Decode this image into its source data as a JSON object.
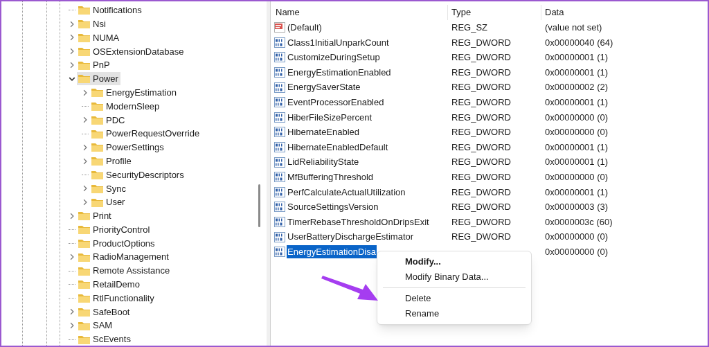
{
  "tree": [
    {
      "label": "Notifications",
      "expandable": false,
      "selected": false
    },
    {
      "label": "Nsi",
      "expandable": true,
      "expanded": false,
      "selected": false
    },
    {
      "label": "NUMA",
      "expandable": true,
      "expanded": false,
      "selected": false
    },
    {
      "label": "OSExtensionDatabase",
      "expandable": true,
      "expanded": false,
      "selected": false
    },
    {
      "label": "PnP",
      "expandable": true,
      "expanded": false,
      "selected": false
    },
    {
      "label": "Power",
      "expandable": true,
      "expanded": true,
      "selected": true,
      "children": [
        {
          "label": "EnergyEstimation",
          "expandable": true,
          "expanded": false,
          "selected": false
        },
        {
          "label": "ModernSleep",
          "expandable": false,
          "selected": false
        },
        {
          "label": "PDC",
          "expandable": true,
          "expanded": false,
          "selected": false
        },
        {
          "label": "PowerRequestOverride",
          "expandable": false,
          "selected": false
        },
        {
          "label": "PowerSettings",
          "expandable": true,
          "expanded": false,
          "selected": false
        },
        {
          "label": "Profile",
          "expandable": true,
          "expanded": false,
          "selected": false
        },
        {
          "label": "SecurityDescriptors",
          "expandable": false,
          "selected": false
        },
        {
          "label": "Sync",
          "expandable": true,
          "expanded": false,
          "selected": false
        },
        {
          "label": "User",
          "expandable": true,
          "expanded": false,
          "selected": false
        }
      ]
    },
    {
      "label": "Print",
      "expandable": true,
      "expanded": false,
      "selected": false
    },
    {
      "label": "PriorityControl",
      "expandable": false,
      "selected": false
    },
    {
      "label": "ProductOptions",
      "expandable": false,
      "selected": false
    },
    {
      "label": "RadioManagement",
      "expandable": true,
      "expanded": false,
      "selected": false
    },
    {
      "label": "Remote Assistance",
      "expandable": false,
      "selected": false
    },
    {
      "label": "RetailDemo",
      "expandable": false,
      "selected": false
    },
    {
      "label": "RtlFunctionality",
      "expandable": false,
      "selected": false
    },
    {
      "label": "SafeBoot",
      "expandable": true,
      "expanded": false,
      "selected": false
    },
    {
      "label": "SAM",
      "expandable": true,
      "expanded": false,
      "selected": false
    },
    {
      "label": "ScEvents",
      "expandable": false,
      "selected": false
    }
  ],
  "values": {
    "columns": [
      "Name",
      "Type",
      "Data"
    ],
    "rows": [
      {
        "kind": "string",
        "name": "(Default)",
        "type": "REG_SZ",
        "data": "(value not set)",
        "selected": false
      },
      {
        "kind": "dword",
        "name": "Class1InitialUnparkCount",
        "type": "REG_DWORD",
        "data": "0x00000040 (64)",
        "selected": false
      },
      {
        "kind": "dword",
        "name": "CustomizeDuringSetup",
        "type": "REG_DWORD",
        "data": "0x00000001 (1)",
        "selected": false
      },
      {
        "kind": "dword",
        "name": "EnergyEstimationEnabled",
        "type": "REG_DWORD",
        "data": "0x00000001 (1)",
        "selected": false
      },
      {
        "kind": "dword",
        "name": "EnergySaverState",
        "type": "REG_DWORD",
        "data": "0x00000002 (2)",
        "selected": false
      },
      {
        "kind": "dword",
        "name": "EventProcessorEnabled",
        "type": "REG_DWORD",
        "data": "0x00000001 (1)",
        "selected": false
      },
      {
        "kind": "dword",
        "name": "HiberFileSizePercent",
        "type": "REG_DWORD",
        "data": "0x00000000 (0)",
        "selected": false
      },
      {
        "kind": "dword",
        "name": "HibernateEnabled",
        "type": "REG_DWORD",
        "data": "0x00000000 (0)",
        "selected": false
      },
      {
        "kind": "dword",
        "name": "HibernateEnabledDefault",
        "type": "REG_DWORD",
        "data": "0x00000001 (1)",
        "selected": false
      },
      {
        "kind": "dword",
        "name": "LidReliabilityState",
        "type": "REG_DWORD",
        "data": "0x00000001 (1)",
        "selected": false
      },
      {
        "kind": "dword",
        "name": "MfBufferingThreshold",
        "type": "REG_DWORD",
        "data": "0x00000000 (0)",
        "selected": false
      },
      {
        "kind": "dword",
        "name": "PerfCalculateActualUtilization",
        "type": "REG_DWORD",
        "data": "0x00000001 (1)",
        "selected": false
      },
      {
        "kind": "dword",
        "name": "SourceSettingsVersion",
        "type": "REG_DWORD",
        "data": "0x00000003 (3)",
        "selected": false
      },
      {
        "kind": "dword",
        "name": "TimerRebaseThresholdOnDripsExit",
        "type": "REG_DWORD",
        "data": "0x0000003c (60)",
        "selected": false
      },
      {
        "kind": "dword",
        "name": "UserBatteryDischargeEstimator",
        "type": "REG_DWORD",
        "data": "0x00000000 (0)",
        "selected": false
      },
      {
        "kind": "dword",
        "name": "EnergyEstimationDisa",
        "data": "0x00000000 (0)",
        "selected": true
      }
    ]
  },
  "context_menu": [
    {
      "kind": "item",
      "label": "Modify...",
      "default": true
    },
    {
      "kind": "item",
      "label": "Modify Binary Data...",
      "default": false
    },
    {
      "kind": "separator"
    },
    {
      "kind": "item",
      "label": "Delete",
      "default": false
    },
    {
      "kind": "item",
      "label": "Rename",
      "default": false
    }
  ]
}
